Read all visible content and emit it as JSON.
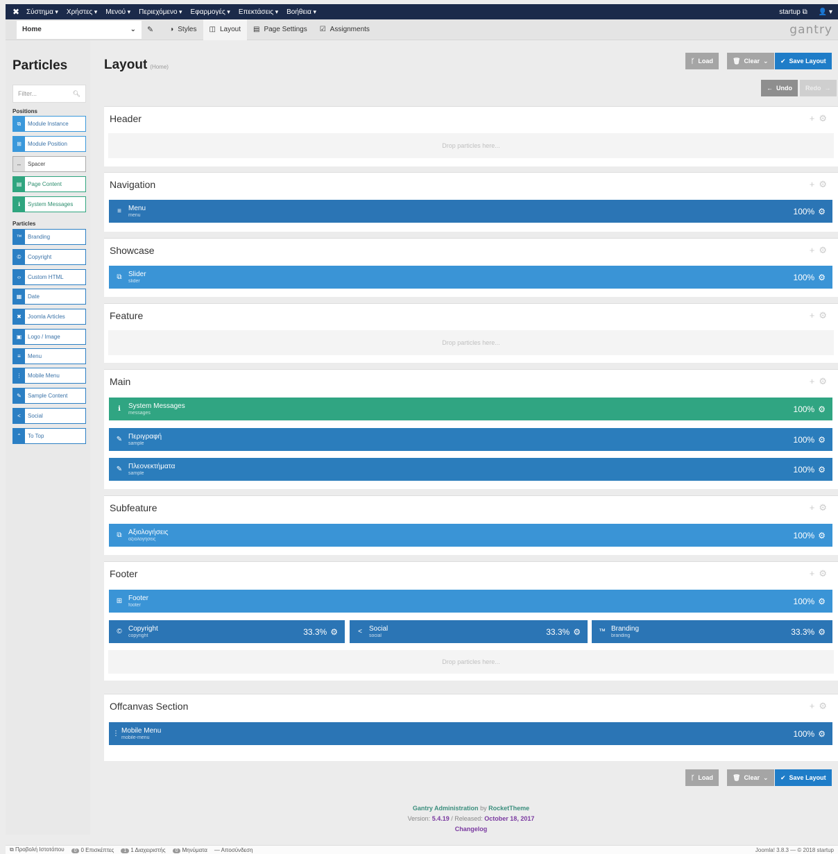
{
  "topbar": {
    "menus": [
      "Σύστημα",
      "Χρήστες",
      "Μενού",
      "Περιεχόμενο",
      "Εφαρμογές",
      "Επεκτάσεις",
      "Βοήθεια"
    ],
    "user": "startup"
  },
  "toolbar": {
    "outline": "Home",
    "tabs": [
      "Styles",
      "Layout",
      "Page Settings",
      "Assignments"
    ],
    "logo": "gantry"
  },
  "sidebar": {
    "title": "Particles",
    "filter_placeholder": "Filter...",
    "positions_label": "Positions",
    "particles_label": "Particles",
    "positions": [
      "Module Instance",
      "Module Position",
      "Spacer",
      "Page Content",
      "System Messages"
    ],
    "particles": [
      "Branding",
      "Copyright",
      "Custom HTML",
      "Date",
      "Joomla Articles",
      "Logo / Image",
      "Menu",
      "Mobile Menu",
      "Sample Content",
      "Social",
      "To Top"
    ]
  },
  "page": {
    "title": "Layout",
    "subtitle": "(Home)",
    "load": "Load",
    "clear": "Clear",
    "save": "Save Layout",
    "undo": "Undo",
    "redo": "Redo"
  },
  "drop_text": "Drop particles here...",
  "sections": {
    "header": {
      "title": "Header"
    },
    "navigation": {
      "title": "Navigation",
      "block": {
        "name": "Menu",
        "sub": "menu",
        "width": "100%"
      }
    },
    "showcase": {
      "title": "Showcase",
      "block": {
        "name": "Slider",
        "sub": "slider",
        "width": "100%"
      }
    },
    "feature": {
      "title": "Feature"
    },
    "main": {
      "title": "Main",
      "blocks": [
        {
          "name": "System Messages",
          "sub": "messages",
          "width": "100%"
        },
        {
          "name": "Περιγραφή",
          "sub": "sample",
          "width": "100%"
        },
        {
          "name": "Πλεονεκτήματα",
          "sub": "sample",
          "width": "100%"
        }
      ]
    },
    "subfeature": {
      "title": "Subfeature",
      "block": {
        "name": "Αξιολογήσεις",
        "sub": "αξιολογήσεις",
        "width": "100%"
      }
    },
    "footer": {
      "title": "Footer",
      "block": {
        "name": "Footer",
        "sub": "footer",
        "width": "100%"
      },
      "row": [
        {
          "name": "Copyright",
          "sub": "copyright",
          "width": "33.3%"
        },
        {
          "name": "Social",
          "sub": "social",
          "width": "33.3%"
        },
        {
          "name": "Branding",
          "sub": "branding",
          "width": "33.3%"
        }
      ]
    },
    "offcanvas": {
      "title": "Offcanvas Section",
      "block": {
        "name": "Mobile Menu",
        "sub": "mobile-menu",
        "width": "100%"
      }
    }
  },
  "gfooter": {
    "line1_a": "Gantry Administration",
    "line1_b": "by",
    "line1_c": "RocketTheme",
    "version_label": "Version:",
    "version": "5.4.19",
    "released_label": "/ Released:",
    "released": "October 18, 2017",
    "changelog": "Changelog"
  },
  "statusbar": {
    "view_site": "Προβολή Ιστοτόπου",
    "visitors_count": "0",
    "visitors": "0 Επισκέπτες",
    "admins_count": "1",
    "admins": "1 Διαχειριστής",
    "messages_count": "0",
    "messages": "Μηνύματα",
    "logout": "Αποσύνδεση",
    "right": "Joomla! 3.8.3 — © 2018 startup"
  }
}
